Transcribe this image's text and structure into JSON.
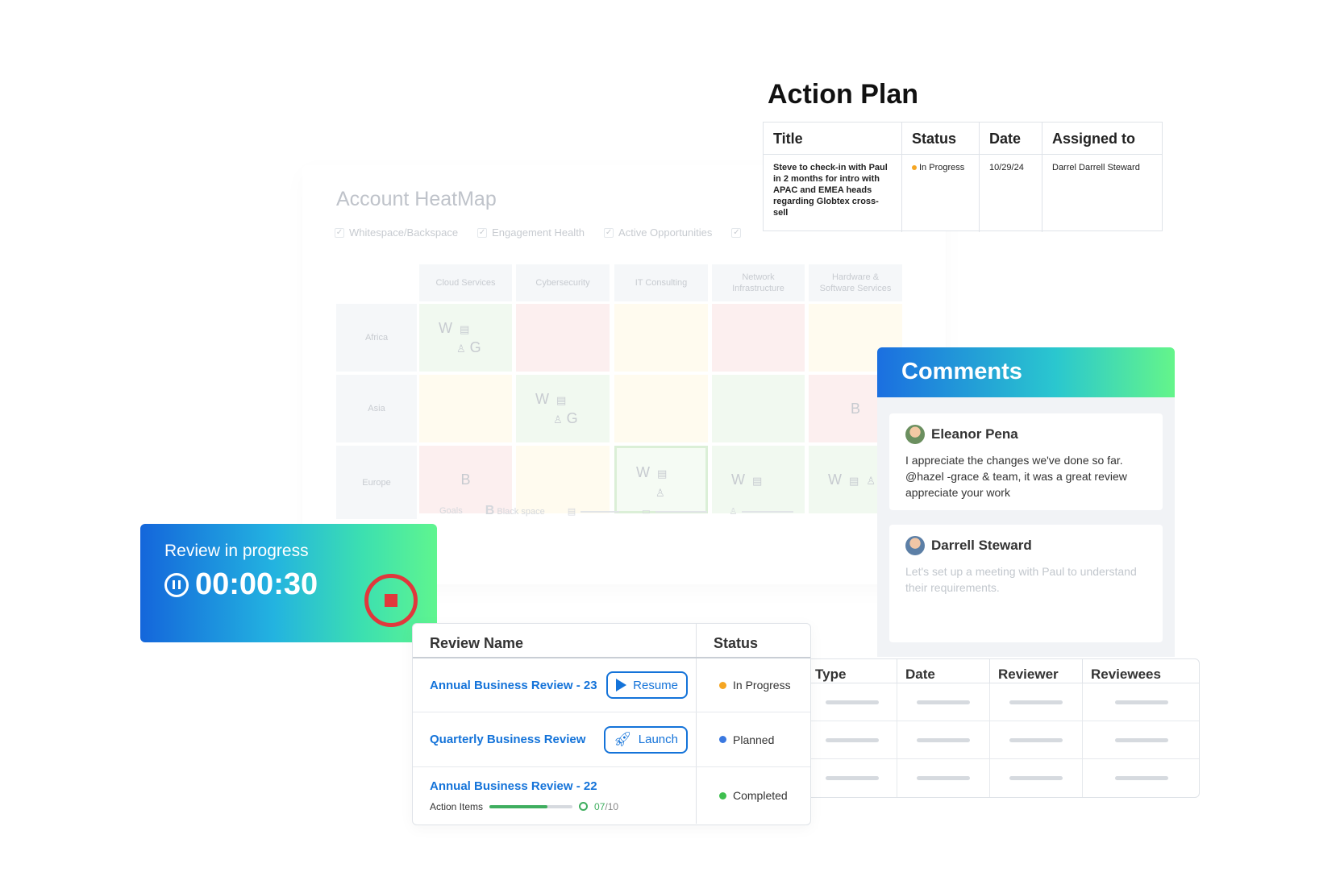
{
  "heatmap": {
    "title": "Account HeatMap",
    "filters": [
      "Whitespace/Backspace",
      "Engagement Health",
      "Active Opportunities"
    ],
    "columns": [
      "Cloud Services",
      "Cybersecurity",
      "IT Consulting",
      "Network\nInfrastructure",
      "Hardware &\nSoftware Services"
    ],
    "rows": [
      "Africa",
      "Asia",
      "Europe"
    ],
    "cell_letters": {
      "w": "W",
      "g": "G",
      "b": "B"
    },
    "footer": {
      "goals": "Goals",
      "black_space_letter": "B",
      "black_space": "Black space"
    }
  },
  "action_plan": {
    "title": "Action Plan",
    "headers": [
      "Title",
      "Status",
      "Date",
      "Assigned to"
    ],
    "row": {
      "title": "Steve to check-in with Paul in 2 months for intro with APAC and EMEA heads regarding Globtex cross-sell",
      "status": "In Progress",
      "status_color": "#f5a623",
      "date": "10/29/24",
      "assigned_to": "Darrel Darrell Steward"
    }
  },
  "comments": {
    "title": "Comments",
    "items": [
      {
        "author": "Eleanor Pena",
        "text": "I appreciate the changes we've done so far. @hazel -grace & team, it was a great review appreciate your work"
      },
      {
        "author": "Darrell Steward",
        "text": "Let's set up a meeting with Paul to understand their requirements."
      }
    ]
  },
  "timer": {
    "label": "Review in progress",
    "value": "00:00:30",
    "stop_color": "#e0383c"
  },
  "review_table": {
    "headers": [
      "Review Name",
      "Status"
    ],
    "rows": [
      {
        "name": "Annual Business Review - 23",
        "button": "Resume",
        "status": "In Progress",
        "status_color": "#f5a623"
      },
      {
        "name": "Quarterly Business Review",
        "button": "Launch",
        "status": "Planned",
        "status_color": "#3a78e0"
      },
      {
        "name": "Annual Business Review - 22",
        "action_items_label": "Action Items",
        "done": "07",
        "total": "/10",
        "progress": 0.7,
        "status": "Completed",
        "status_color": "#3fbf4f"
      }
    ]
  },
  "detail_table": {
    "headers": [
      "Type",
      "Date",
      "Reviewer",
      "Reviewees"
    ]
  }
}
